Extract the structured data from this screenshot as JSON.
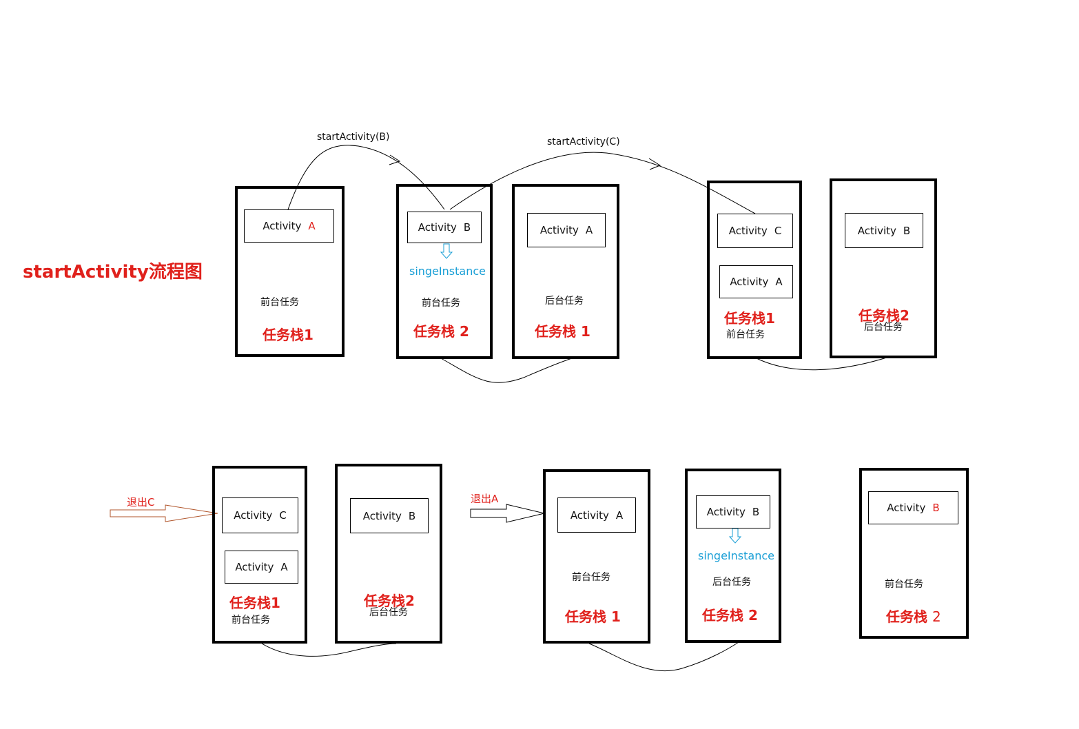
{
  "title": "startActivity流程图",
  "labels": {
    "activity": "Activity",
    "a": "A",
    "b": "B",
    "c": "C",
    "foreground": "前台任务",
    "background": "后台任务",
    "stack1": "任务栈1",
    "stack2": "任务栈2",
    "stack_num_prefix": "任务栈",
    "num1": "1",
    "num2": "2",
    "single_instance": "singeInstance",
    "call_b": "startActivity(B)",
    "call_c": "startActivity(C)",
    "exit_c": "退出C",
    "exit_a": "退出A"
  },
  "colors": {
    "red": "#e0211c",
    "blue": "#1a9fd6",
    "black": "#000000",
    "exit_c_arrow": "#b0552b"
  }
}
